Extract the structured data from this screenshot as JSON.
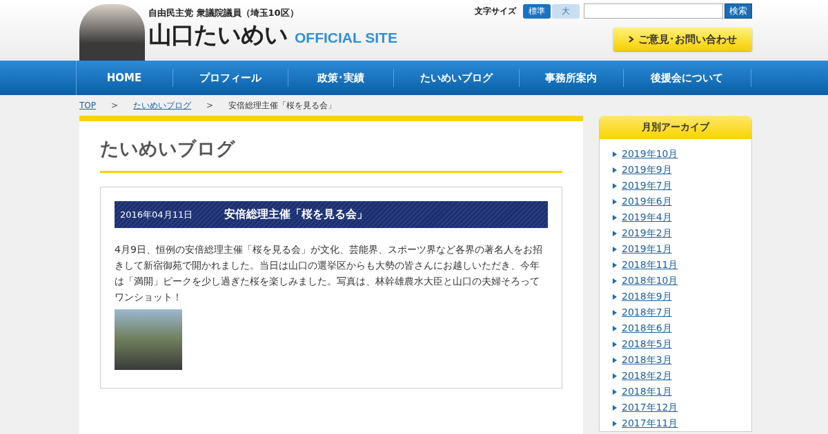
{
  "header": {
    "party_line": "自由民主党 衆議院議員（埼玉10区）",
    "name": "山口たいめい",
    "site_label": "OFFICIAL SITE",
    "font_size_label": "文字サイズ",
    "font_sizes": [
      {
        "label": "標準",
        "selected": true
      },
      {
        "label": "大",
        "selected": false
      }
    ],
    "search": {
      "button": "検索"
    },
    "contact_button": "ご意見･お問い合わせ"
  },
  "nav": [
    {
      "label": "HOME"
    },
    {
      "label": "プロフィール"
    },
    {
      "label": "政策･実績"
    },
    {
      "label": "たいめいブログ"
    },
    {
      "label": "事務所案内"
    },
    {
      "label": "後援会について"
    }
  ],
  "breadcrumb": {
    "links": [
      "TOP",
      "たいめいブログ"
    ],
    "separator": ">",
    "current": "安倍総理主催「桜を見る会」"
  },
  "main": {
    "heading": "たいめいブログ",
    "post": {
      "date": "2016年04月11日",
      "title": "安倍総理主催「桜を見る会」",
      "body": "4月9日、恒例の安倍総理主催「桜を見る会」が文化、芸能界、スポーツ界など各界の著名人をお招きして新宿御苑で開かれました。当日は山口の選挙区からも大勢の皆さんにお越しいただき、今年は「満開」ピークを少し過ぎた桜を楽しみました。写真は、林幹雄農水大臣と山口の夫婦そろってワンショット！"
    }
  },
  "sidebar": {
    "title": "月別アーカイブ",
    "items": [
      "2019年10月",
      "2019年9月",
      "2019年7月",
      "2019年6月",
      "2019年4月",
      "2019年2月",
      "2019年1月",
      "2018年11月",
      "2018年10月",
      "2018年9月",
      "2018年7月",
      "2018年6月",
      "2018年5月",
      "2018年3月",
      "2018年2月",
      "2018年1月",
      "2017年12月",
      "2017年11月"
    ]
  }
}
